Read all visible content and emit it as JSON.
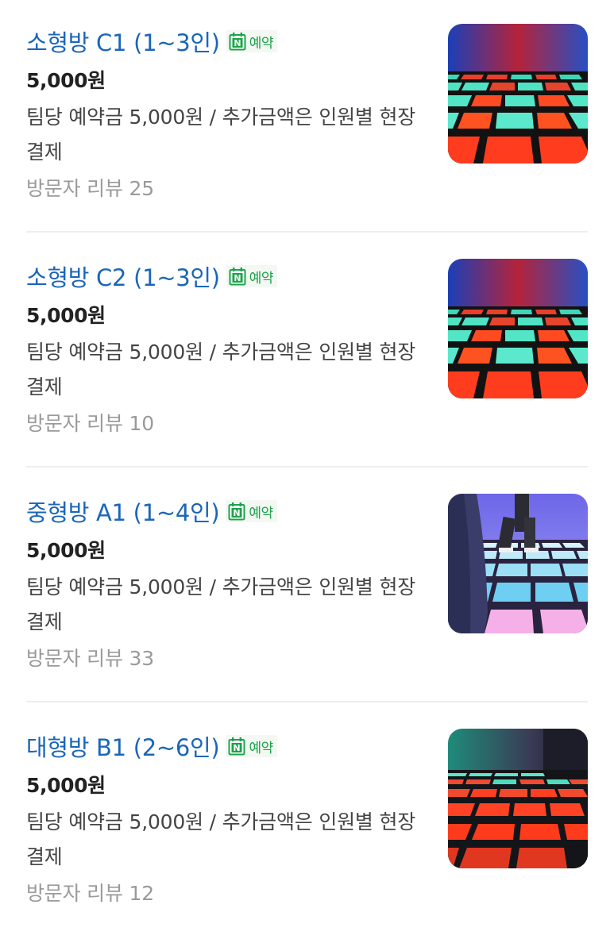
{
  "badge": {
    "label": "예약",
    "icon_letter": "N",
    "icon": "naver-calendar-icon",
    "color": "#1ca34a"
  },
  "items": [
    {
      "title": "소형방 C1 (1~3인)",
      "price": "5,000원",
      "description": "팀당 예약금 5,000원 / 추가금액은 인원별 현장결제",
      "review": "방문자 리뷰 25",
      "thumbnail": "led-floor-red-green"
    },
    {
      "title": "소형방 C2 (1~3인)",
      "price": "5,000원",
      "description": "팀당 예약금 5,000원 / 추가금액은 인원별 현장결제",
      "review": "방문자 리뷰 10",
      "thumbnail": "led-floor-red-green"
    },
    {
      "title": "중형방 A1 (1~4인)",
      "price": "5,000원",
      "description": "팀당 예약금 5,000원 / 추가금액은 인원별 현장결제",
      "review": "방문자 리뷰 33",
      "thumbnail": "led-floor-blue-pink"
    },
    {
      "title": "대형방 B1 (2~6인)",
      "price": "5,000원",
      "description": "팀당 예약금 5,000원 / 추가금액은 인원별 현장결제",
      "review": "방문자 리뷰 12",
      "thumbnail": "led-floor-dark-red"
    }
  ],
  "colors": {
    "title": "#1a66b8",
    "price": "#222222",
    "description": "#444444",
    "review": "#9a9a9a",
    "divider": "#eeeeee"
  }
}
